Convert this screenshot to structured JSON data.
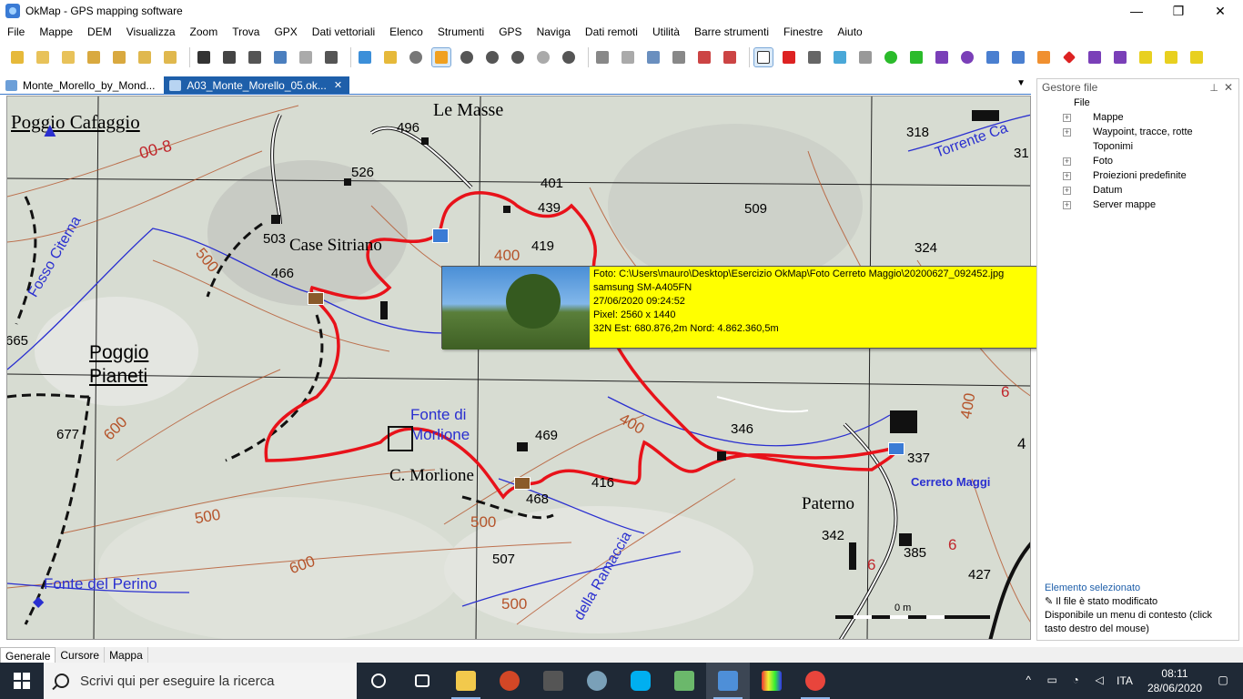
{
  "window": {
    "title": "OkMap - GPS mapping software",
    "minimize": "—",
    "maximize": "❐",
    "close": "✕"
  },
  "menu": [
    "File",
    "Mappe",
    "DEM",
    "Visualizza",
    "Zoom",
    "Trova",
    "GPX",
    "Dati vettoriali",
    "Elenco",
    "Strumenti",
    "GPS",
    "Naviga",
    "Dati remoti",
    "Utilità",
    "Barre strumenti",
    "Finestre",
    "Aiuto"
  ],
  "tabs": [
    {
      "label": "Monte_Morello_by_Mond...",
      "active": false
    },
    {
      "label": "A03_Monte_Morello_05.ok...",
      "active": true
    }
  ],
  "map": {
    "place_labels": {
      "poggio_cafaggio": "Poggio Cafaggio",
      "le_masse": "Le Masse",
      "case_sitriano": "Case Sitriano",
      "poggio_pianeti_1": "Poggio",
      "poggio_pianeti_2": "Pianeti",
      "fonte_di_morlione_1": "Fonte di",
      "fonte_di_morlione_2": "Morlione",
      "c_morlione": "C. Morlione",
      "paterno": "Paterno",
      "cerreto_maggi": "Cerreto Maggi",
      "fonte_del_perino": "Fonte del Perino",
      "fosso_citerna": "Fosso Citerna",
      "torrente": "Torrente Ca",
      "della_ramaccia": "della Ramaccia"
    },
    "spot_heights": [
      "496",
      "526",
      "503",
      "466",
      "401",
      "439",
      "419",
      "509",
      "318",
      "324",
      "665",
      "677",
      "469",
      "416",
      "468",
      "346",
      "337",
      "342",
      "385",
      "427",
      "507",
      "31"
    ],
    "contour_labels": [
      "00-8",
      "500",
      "400",
      "600",
      "500",
      "400",
      "500",
      "500",
      "600",
      "400",
      "6",
      "6",
      "6",
      "4"
    ],
    "scale": "0 m"
  },
  "photo_popup": {
    "line1": "Foto: C:\\Users\\mauro\\Desktop\\Esercizio OkMap\\Foto Cerreto Maggio\\20200627_092452.jpg",
    "line2": "samsung SM-A405FN",
    "line3": "27/06/2020 09:24:52",
    "line4": "Pixel: 2560 x 1440",
    "line5": "32N  Est: 680.876,2m  Nord: 4.862.360,5m"
  },
  "panel": {
    "title": "Gestore file",
    "pin": "📌",
    "close": "✕",
    "root": "File",
    "items": [
      {
        "label": "Mappe",
        "expandable": true
      },
      {
        "label": "Waypoint, tracce, rotte",
        "expandable": true
      },
      {
        "label": "Toponimi",
        "expandable": false
      },
      {
        "label": "Foto",
        "expandable": true
      },
      {
        "label": "Proiezioni predefinite",
        "expandable": true
      },
      {
        "label": "Datum",
        "expandable": true
      },
      {
        "label": "Server mappe",
        "expandable": true
      }
    ],
    "selected_title": "Elemento selezionato",
    "modified": "Il file è stato modificato",
    "context": "Disponibile un menu di contesto (click tasto destro del mouse)"
  },
  "bottom_tabs": [
    "Generale",
    "Cursore",
    "Mappa"
  ],
  "taskbar": {
    "search_placeholder": "Scrivi qui per eseguire la ricerca",
    "language": "ITA",
    "time": "08:11",
    "date": "28/06/2020"
  },
  "colors": {
    "track": "#e8121a",
    "water": "#2a2fd0",
    "contour": "#b5542b",
    "popup": "#ffff00",
    "accent": "#1e5faa"
  }
}
